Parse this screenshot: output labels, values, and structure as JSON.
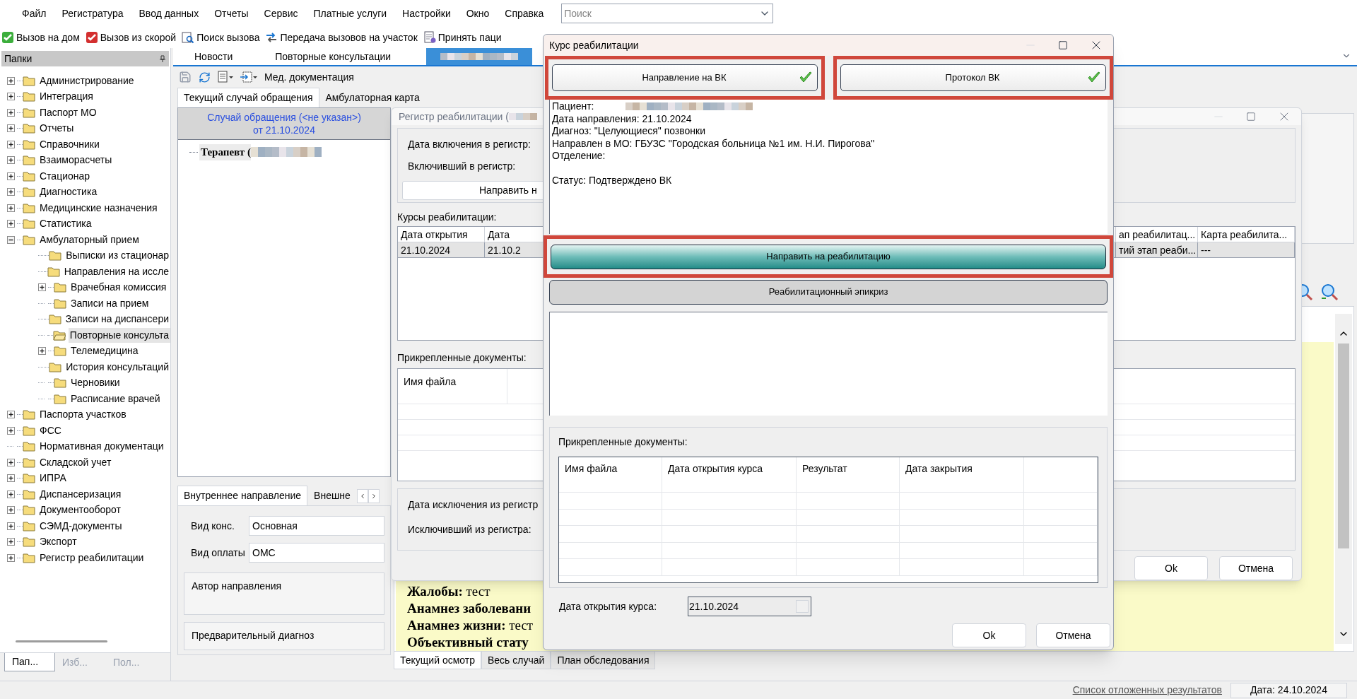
{
  "menu": [
    "Файл",
    "Регистратура",
    "Ввод данных",
    "Отчеты",
    "Сервис",
    "Платные услуги",
    "Настройки",
    "Окно",
    "Справка"
  ],
  "search": {
    "placeholder": "Поиск"
  },
  "toolbar": [
    {
      "label": "Вызов на дом",
      "kind": "home"
    },
    {
      "label": "Вызов из скорой",
      "kind": "ambulance"
    },
    {
      "label": "Поиск вызова",
      "kind": "search"
    },
    {
      "label": "Передача вызовов на участок",
      "kind": "transfer"
    },
    {
      "label": "Принять паци",
      "kind": "accept"
    }
  ],
  "sidebar": {
    "title": "Папки",
    "items": [
      {
        "label": "Администрирование",
        "expanded": false,
        "selected": false
      },
      {
        "label": "Интеграция",
        "expanded": false,
        "selected": false
      },
      {
        "label": "Паспорт МО",
        "expanded": false,
        "selected": false
      },
      {
        "label": "Отчеты",
        "expanded": false,
        "selected": false
      },
      {
        "label": "Справочники",
        "expanded": false,
        "selected": false
      },
      {
        "label": "Взаиморасчеты",
        "expanded": false,
        "selected": false
      },
      {
        "label": "Стационар",
        "expanded": false,
        "selected": false
      },
      {
        "label": "Диагностика",
        "expanded": false,
        "selected": false
      },
      {
        "label": "Медицинские назначения",
        "expanded": false,
        "selected": false
      },
      {
        "label": "Статистика",
        "expanded": false,
        "selected": false
      },
      {
        "label": "Амбулаторный прием",
        "expanded": true,
        "selected": false,
        "children": [
          {
            "label": "Выписки из стационар",
            "selected": false
          },
          {
            "label": "Направления на иссле",
            "selected": false
          },
          {
            "label": "Врачебная комиссия",
            "expanded": false,
            "selected": false
          },
          {
            "label": "Записи на прием",
            "selected": false
          },
          {
            "label": "Записи на диспансери",
            "selected": false
          },
          {
            "label": "Повторные консульта",
            "selected": true
          },
          {
            "label": "Телемедицина",
            "expanded": false,
            "selected": false
          },
          {
            "label": "История консультаций",
            "selected": false
          },
          {
            "label": "Черновики",
            "selected": false
          },
          {
            "label": "Расписание врачей",
            "selected": false
          }
        ]
      },
      {
        "label": "Паспорта участков",
        "expanded": false,
        "selected": false
      },
      {
        "label": "ФСС",
        "expanded": false,
        "selected": false
      },
      {
        "label": "Нормативная документаци",
        "selected": false
      },
      {
        "label": "Складской учет",
        "expanded": false,
        "selected": false
      },
      {
        "label": "ИПРА",
        "expanded": false,
        "selected": false
      },
      {
        "label": "Диспансеризация",
        "expanded": false,
        "selected": false
      },
      {
        "label": "Документооборот",
        "expanded": false,
        "selected": false
      },
      {
        "label": "СЭМД-документы",
        "expanded": false,
        "selected": false
      },
      {
        "label": "Экспорт",
        "expanded": false,
        "selected": false
      },
      {
        "label": "Регистр реабилитации",
        "expanded": false,
        "selected": false
      }
    ],
    "tabs": [
      {
        "label": "Пап...",
        "selected": true
      },
      {
        "label": "Изб...",
        "selected": false
      },
      {
        "label": "Пол...",
        "selected": false
      }
    ]
  },
  "main_tabs": [
    {
      "label": "Новости",
      "selected": false,
      "kind": "text"
    },
    {
      "label": "Повторные консультации",
      "selected": false,
      "kind": "text"
    },
    {
      "selected": true,
      "kind": "redacted"
    }
  ],
  "doc_toolbar": {
    "label": "Мед. документация"
  },
  "case_tabs": [
    {
      "label": "Текущий случай обращения",
      "selected": true
    },
    {
      "label": "Амбулаторная карта",
      "selected": false
    }
  ],
  "case_panel": {
    "title": "Случай обращения (<не указан>)",
    "subtitle": "от 21.10.2024",
    "node": "Терапевт ("
  },
  "direction_tabs": [
    {
      "label": "Внутреннее направление",
      "selected": true
    },
    {
      "label": "Внешне",
      "selected": false
    }
  ],
  "direction_fields": [
    {
      "label": "Вид конс.",
      "value": "Основная"
    },
    {
      "label": "Вид оплаты",
      "value": "ОМС"
    }
  ],
  "direction_groups": [
    "Автор направления",
    "Предварительный диагноз"
  ],
  "exam": [
    {
      "label": "Жалобы:",
      "value": "тест"
    },
    {
      "label": "Анамнез заболевани"
    },
    {
      "label": "Анамнез жизни:",
      "value": "тест"
    },
    {
      "label": "Объективный стату"
    }
  ],
  "exam_tabs": [
    {
      "label": "Текущий осмотр",
      "selected": true
    },
    {
      "label": "Весь случай",
      "selected": false
    },
    {
      "label": "План обследования",
      "selected": false
    }
  ],
  "register_dialog": {
    "title": "Регистр реабилитации (",
    "fields": [
      "Дата включения в регистр:",
      "Включивший в регистр:"
    ],
    "send_button": "Направить н",
    "courses_label": "Курсы реабилитации:",
    "courses_columns": [
      "Дата открытия",
      "Дата",
      "ап реабилитац...",
      "Карта реабилита..."
    ],
    "courses_rows": [
      {
        "cells": [
          "21.10.2024",
          "21.10.2",
          "тий этап реаби...",
          "---"
        ],
        "selected": true
      }
    ],
    "docs_label": "Прикрепленные документы:",
    "docs_columns": [
      "Имя файла"
    ],
    "exclusion_fields": [
      "Дата исключения из регистр",
      "Исключивший из регистра:"
    ],
    "buttons": [
      "Ok",
      "Отмена"
    ]
  },
  "course_dialog": {
    "title": "Курс реабилитации",
    "top_buttons": [
      {
        "label": "Направление на ВК",
        "done": true,
        "highlighted": true
      },
      {
        "label": "Протокол ВК",
        "done": true,
        "highlighted": true
      }
    ],
    "patient_label": "Пациент:",
    "info_lines": [
      "Дата направления: 21.10.2024",
      "Диагноз: \"Целующиеся\" позвонки",
      "Направлен в МО: ГБУЗС \"Городская больница №1 им. Н.И. Пирогова\"",
      "Отделение:"
    ],
    "status": "Статус: Подтверждено ВК",
    "actions": [
      {
        "label": "Направить на реабилитацию",
        "kind": "primary",
        "highlighted": true
      },
      {
        "label": "Реабилитационный эпикриз",
        "kind": "secondary",
        "highlighted": false
      }
    ],
    "docs_label": "Прикрепленные документы:",
    "docs_columns": [
      "Имя файла",
      "Дата открытия курса",
      "Результат",
      "Дата закрытия"
    ],
    "date_field": {
      "label": "Дата открытия курса:",
      "value": "21.10.2024"
    },
    "buttons": [
      "Ok",
      "Отмена"
    ]
  },
  "status_bar": {
    "link": "Список отложенных результатов",
    "date": "Дата: 24.10.2024"
  }
}
